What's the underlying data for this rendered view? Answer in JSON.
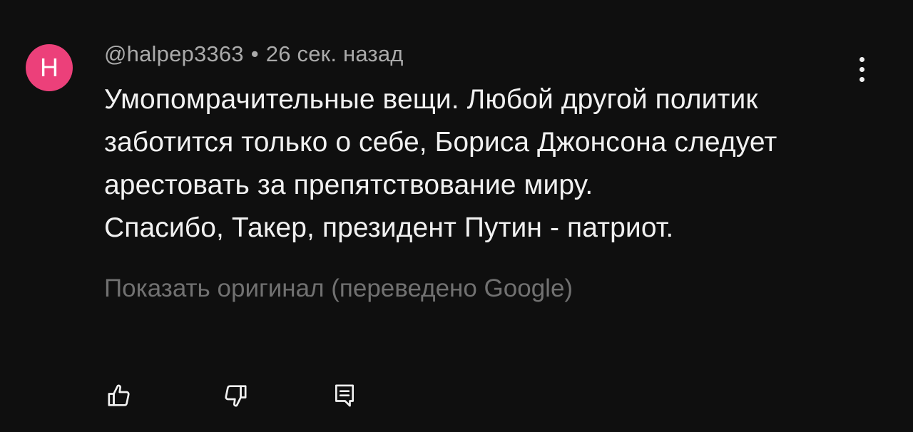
{
  "comment": {
    "avatar_letter": "H",
    "avatar_color": "#ec407a",
    "author": "@halpep3363",
    "separator": "•",
    "timestamp": "26 сек. назад",
    "body_lines": [
      "Умопомрачительные вещи. Любой другой политик",
      "заботится только о себе, Бориса Джонсона следует",
      "арестовать за препятствование миру.",
      "Спасибо, Такер, президент Путин - патриот."
    ],
    "translate_link": "Показать оригинал (переведено Google)",
    "actions": {
      "like_icon": "thumbs-up-icon",
      "dislike_icon": "thumbs-down-icon",
      "reply_icon": "reply-icon"
    },
    "menu_icon": "more-vert-icon"
  },
  "colors": {
    "background": "#0f0f0f",
    "text_primary": "#f1f1f1",
    "text_secondary": "#aaaaaa",
    "text_muted": "#717171"
  }
}
